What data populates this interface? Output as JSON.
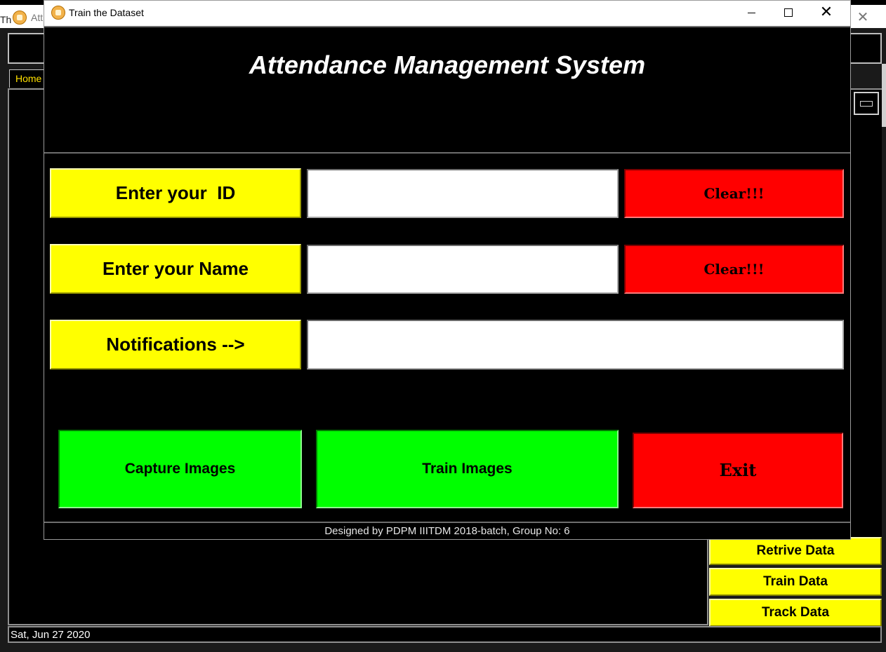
{
  "background_window": {
    "edge_text": "Th",
    "title": "Att",
    "home_tab": "Home",
    "side_buttons": [
      "Retrive Data",
      "Train Data",
      "Track Data"
    ],
    "status_date": "Sat, Jun 27 2020"
  },
  "dialog": {
    "title": "Train the Dataset",
    "heading": "Attendance Management System",
    "id_label": "Enter your  ID",
    "name_label": "Enter your Name",
    "notifications_label": "Notifications -->",
    "id_value": "",
    "name_value": "",
    "notification_text": "",
    "clear_label": "Clear!!!",
    "capture_label": "Capture Images",
    "train_label": "Train Images",
    "exit_label": "Exit",
    "footer": "Designed by PDPM IIITDM 2018-batch, Group No: 6"
  },
  "colors": {
    "label_bg": "#ffff00",
    "clear_bg": "#ff0000",
    "action_bg": "#00ff00",
    "panel_bg": "#000000"
  },
  "icons": [
    "app-icon",
    "minimize-icon",
    "maximize-icon",
    "close-icon"
  ]
}
